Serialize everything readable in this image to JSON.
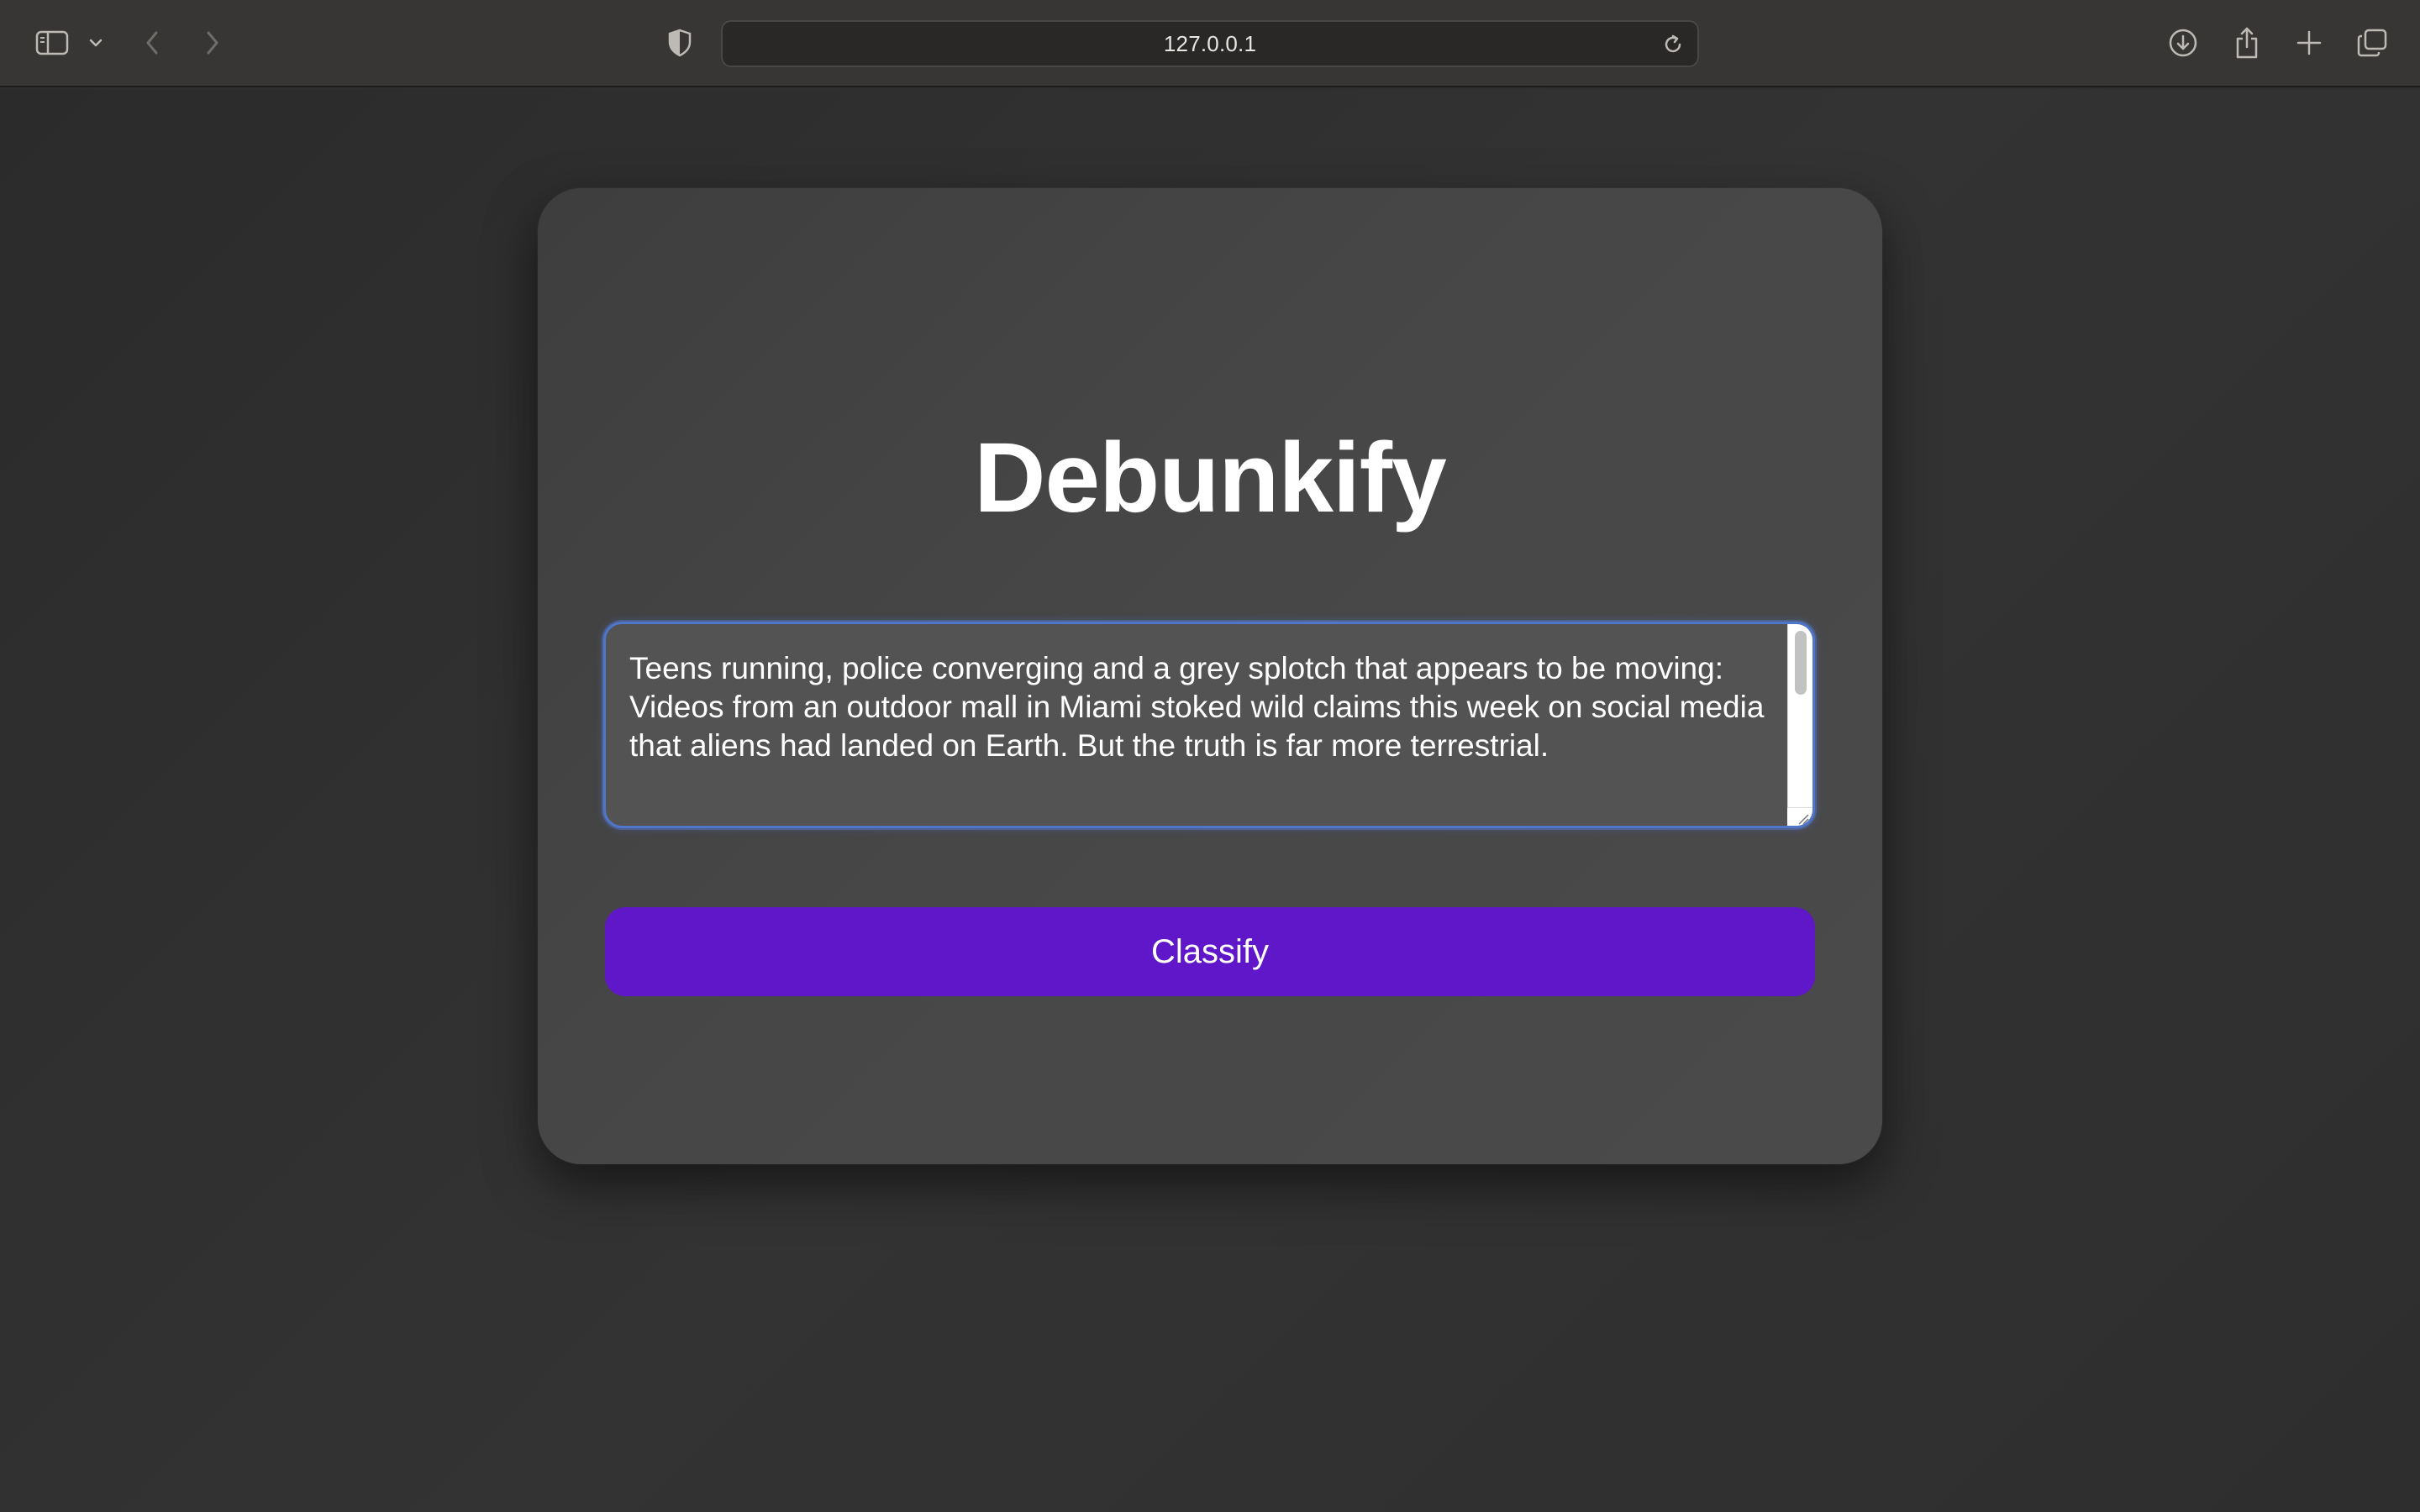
{
  "browser": {
    "address": "127.0.0.1",
    "icons": [
      "sidebar-icon",
      "chevron-down-icon",
      "back-icon",
      "forward-icon",
      "shield-icon",
      "reload-icon",
      "download-icon",
      "share-icon",
      "new-tab-icon",
      "tabs-overview-icon"
    ]
  },
  "app": {
    "title": "Debunkify",
    "input_text": "Teens running, police converging and a grey splotch that appears to be moving: Videos from an outdoor mall in Miami stoked wild claims this week on social media that aliens had landed on Earth. But the truth is far more terrestrial.",
    "classify_label": "Classify",
    "colors": {
      "accent": "#5f17c9",
      "focus_ring": "#4f76c9",
      "card": "#474747",
      "background": "#2f2f2f"
    }
  }
}
